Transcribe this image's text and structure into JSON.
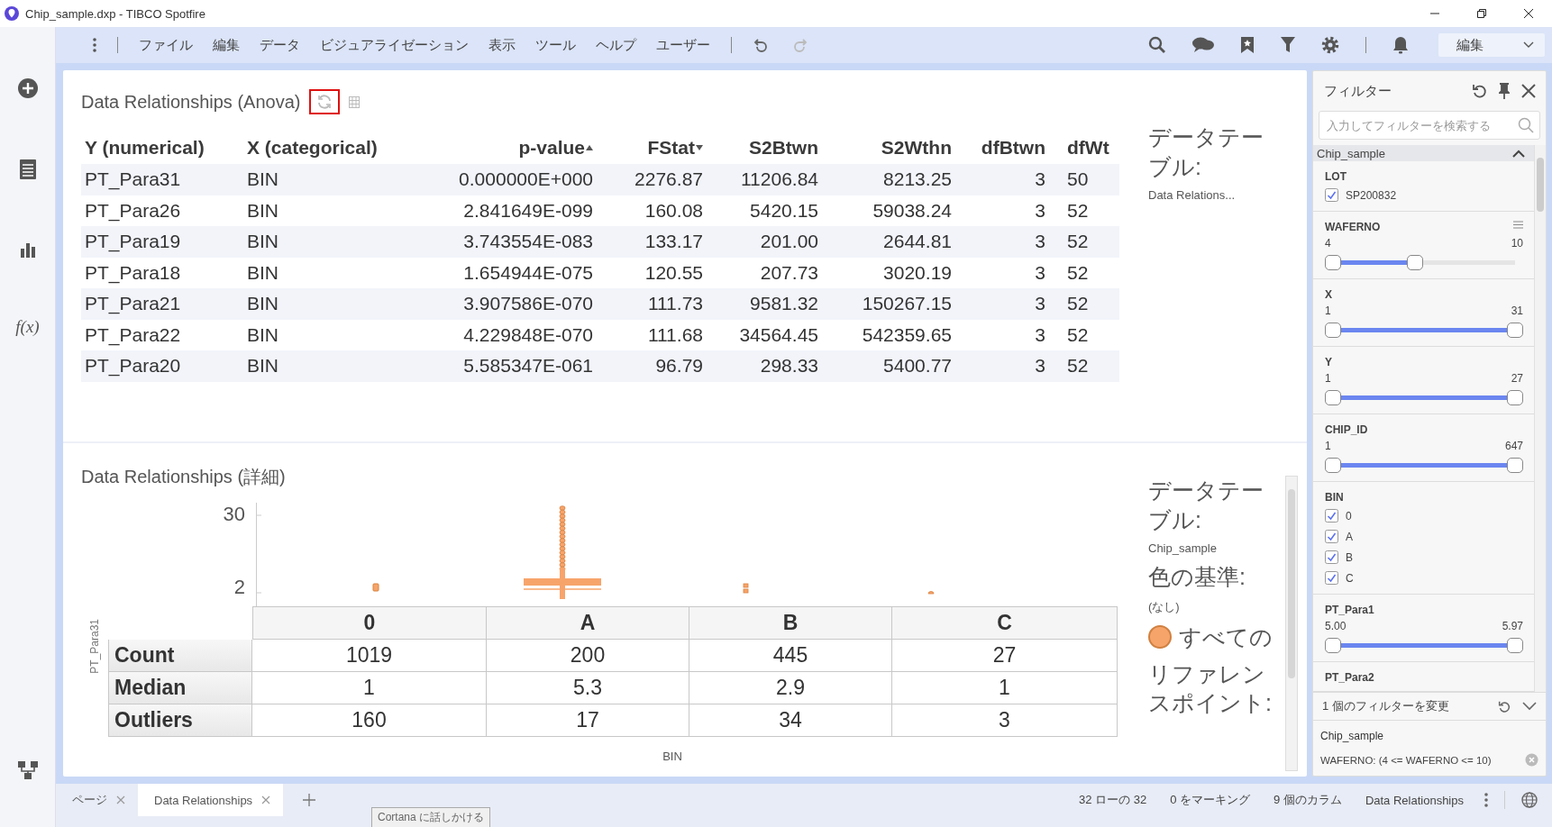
{
  "window": {
    "title": "Chip_sample.dxp - TIBCO Spotfire"
  },
  "toolbar": {
    "menus": [
      "ファイル",
      "編集",
      "データ",
      "ビジュアライゼーション",
      "表示",
      "ツール",
      "ヘルプ",
      "ユーザー"
    ],
    "history": [
      {
        "kind": "undo",
        "disabled": false
      },
      {
        "kind": "redo",
        "disabled": true
      }
    ],
    "mode": "編集"
  },
  "sidebar": {
    "formula_label": "f(x)"
  },
  "anova": {
    "title": "Data Relationships (Anova)",
    "columns": [
      {
        "label": "Y (numerical)",
        "numeric": false,
        "sorted_ascending": false,
        "sorted_descending": false
      },
      {
        "label": "X (categorical)",
        "numeric": false,
        "sorted_ascending": false,
        "sorted_descending": false
      },
      {
        "label": "p-value",
        "numeric": true,
        "sorted_ascending": true,
        "sorted_descending": false
      },
      {
        "label": "FStat",
        "numeric": true,
        "sorted_ascending": false,
        "sorted_descending": true
      },
      {
        "label": "S2Btwn",
        "numeric": true,
        "sorted_ascending": false,
        "sorted_descending": false
      },
      {
        "label": "S2Wthn",
        "numeric": true,
        "sorted_ascending": false,
        "sorted_descending": false
      },
      {
        "label": "dfBtwn",
        "numeric": true,
        "sorted_ascending": false,
        "sorted_descending": false
      },
      {
        "label": "dfWt",
        "numeric": false,
        "sorted_ascending": false,
        "sorted_descending": false
      }
    ],
    "rows": [
      [
        "PT_Para31",
        "BIN",
        "0.000000E+000",
        "2276.87",
        "11206.84",
        "8213.25",
        "3",
        "50"
      ],
      [
        "PT_Para26",
        "BIN",
        "2.841649E-099",
        "160.08",
        "5420.15",
        "59038.24",
        "3",
        "52"
      ],
      [
        "PT_Para19",
        "BIN",
        "3.743554E-083",
        "133.17",
        "201.00",
        "2644.81",
        "3",
        "52"
      ],
      [
        "PT_Para18",
        "BIN",
        "1.654944E-075",
        "120.55",
        "207.73",
        "3020.19",
        "3",
        "52"
      ],
      [
        "PT_Para21",
        "BIN",
        "3.907586E-070",
        "111.73",
        "9581.32",
        "150267.15",
        "3",
        "52"
      ],
      [
        "PT_Para22",
        "BIN",
        "4.229848E-070",
        "111.68",
        "34564.45",
        "542359.65",
        "3",
        "52"
      ],
      [
        "PT_Para20",
        "BIN",
        "5.585347E-061",
        "96.79",
        "298.33",
        "5400.77",
        "3",
        "52"
      ]
    ],
    "legend": {
      "heading": "データテーブル:",
      "table": "Data Relations..."
    }
  },
  "detail": {
    "title": "Data Relationships (詳細)",
    "y_axis_title": "PT_Para31",
    "y_ticks": [
      "30",
      "2"
    ],
    "x_axis_title": "BIN",
    "stats": {
      "columns": [
        "0",
        "A",
        "B",
        "C"
      ],
      "rows": [
        {
          "label": "Count",
          "values": [
            "1019",
            "200",
            "445",
            "27"
          ]
        },
        {
          "label": "Median",
          "values": [
            "1",
            "5.3",
            "2.9",
            "1"
          ]
        },
        {
          "label": "Outliers",
          "values": [
            "160",
            "17",
            "34",
            "3"
          ]
        }
      ]
    },
    "legend": {
      "heading": "データテーブル:",
      "table": "Chip_sample",
      "color_heading": "色の基準:",
      "color_value": "(なし)",
      "entries": [
        {
          "label": "すべての",
          "color": "#f7a46b"
        }
      ],
      "reference_heading": "リファレンスポイント:"
    }
  },
  "filters": {
    "title": "フィルター",
    "search_placeholder": "入力してフィルターを検索する",
    "group": {
      "name": "Chip_sample",
      "expanded": true
    },
    "items": [
      {
        "kind": "checklist",
        "name": "LOT",
        "has_menu": false,
        "options": [
          {
            "label": "SP200832",
            "checked": true
          }
        ]
      },
      {
        "kind": "range",
        "name": "WAFERNO",
        "has_menu": true,
        "min": "4",
        "max": "10",
        "level": 0.45
      },
      {
        "kind": "range",
        "name": "X",
        "has_menu": false,
        "min": "1",
        "max": "31",
        "level": 1
      },
      {
        "kind": "range",
        "name": "Y",
        "has_menu": false,
        "min": "1",
        "max": "27",
        "level": 1
      },
      {
        "kind": "range",
        "name": "CHIP_ID",
        "has_menu": false,
        "min": "1",
        "max": "647",
        "level": 1
      },
      {
        "kind": "checklist",
        "name": "BIN",
        "has_menu": false,
        "options": [
          {
            "label": "0",
            "checked": true
          },
          {
            "label": "A",
            "checked": true
          },
          {
            "label": "B",
            "checked": true
          },
          {
            "label": "C",
            "checked": true
          }
        ]
      },
      {
        "kind": "range",
        "name": "PT_Para1",
        "has_menu": false,
        "min": "5.00",
        "max": "5.97",
        "level": 1
      },
      {
        "kind": "range",
        "name": "PT_Para2",
        "has_menu": false
      }
    ],
    "changes": {
      "text": "1 個のフィルターを変更",
      "table": "Chip_sample",
      "expression": "WAFERNO: (4 <= WAFERNO <= 10)"
    }
  },
  "tabs": [
    {
      "label": "ページ",
      "selected": false
    },
    {
      "label": "Data Relationships",
      "selected": true
    }
  ],
  "tooltip": "Cortana に話しかける",
  "status": [
    "32 ローの 32",
    "0 をマーキング",
    "9 個のカラム",
    "Data Relationships"
  ]
}
